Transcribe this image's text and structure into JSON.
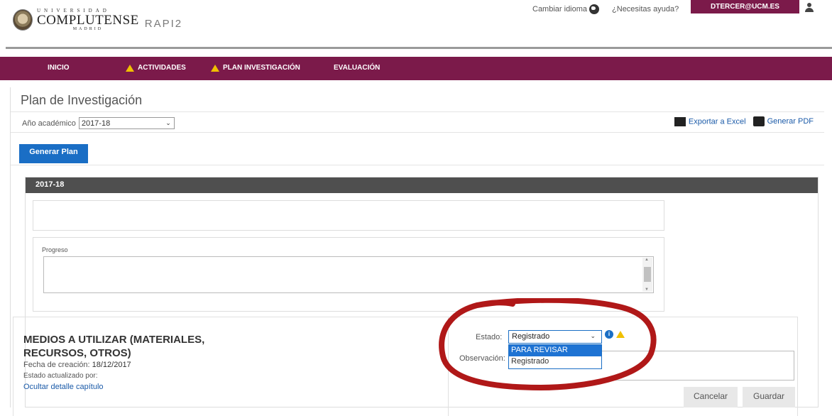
{
  "header": {
    "logo_top": "UNIVERSIDAD",
    "logo_main": "COMPLUTENSE",
    "logo_sub": "MADRID",
    "app_name": "RAPI2",
    "change_language": "Cambiar idioma",
    "help": "¿Necesitas ayuda?",
    "user": "DTERCER@UCM.ES"
  },
  "nav": {
    "items": [
      "INICIO",
      "ACTIVIDADES",
      "PLAN INVESTIGACIÓN",
      "EVALUACIÓN"
    ]
  },
  "page": {
    "title": "Plan de Investigación",
    "year_label": "Año académico",
    "year_value": "2017-18",
    "export_excel": "Exportar a Excel",
    "generate_pdf": "Generar PDF",
    "generate_plan": "Generar Plan"
  },
  "panel": {
    "header": "2017-18",
    "progress_label": "Progreso",
    "chapter_title": "MEDIOS A UTILIZAR (MATERIALES, RECURSOS, OTROS)",
    "created_label": "Fecha de creación:",
    "created_value": "18/12/2017",
    "updated_label": "Estado actualizado por:",
    "hide_detail": "Ocultar detalle capítulo"
  },
  "form": {
    "estado_label": "Estado:",
    "estado_value": "Registrado",
    "options": [
      "PARA REVISAR",
      "Registrado"
    ],
    "observacion_label": "Observación:",
    "cancel": "Cancelar",
    "save": "Guardar"
  },
  "colors": {
    "brand": "#7b1a4a",
    "accent": "#1a6ec5",
    "annotation": "#b01818"
  }
}
